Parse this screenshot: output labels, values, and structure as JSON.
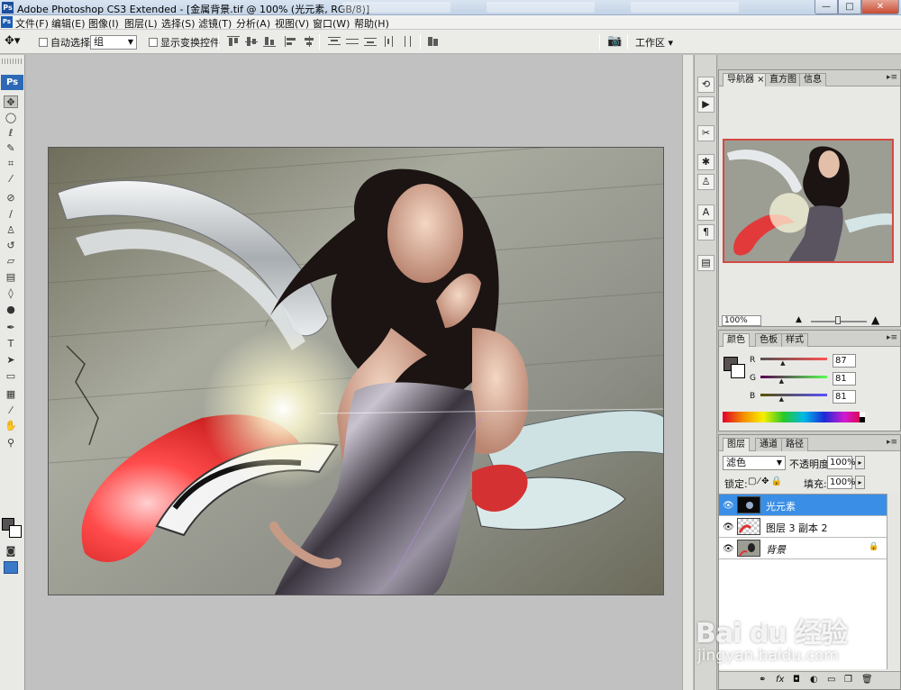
{
  "window": {
    "title": "Adobe Photoshop CS3 Extended - [金属背景.tif @ 100% (光元素, RGB/8)]",
    "controls": {
      "minimize": "—",
      "maximize": "□",
      "close": "✕"
    }
  },
  "menubar": {
    "items": [
      "文件(F)",
      "编辑(E)",
      "图像(I)",
      "图层(L)",
      "选择(S)",
      "滤镜(T)",
      "分析(A)",
      "视图(V)",
      "窗口(W)",
      "帮助(H)"
    ]
  },
  "options": {
    "auto_select_label": "自动选择:",
    "auto_select_value": "组",
    "show_transform_label": "显示变换控件",
    "workspace_label": "工作区 ▾"
  },
  "toolbox": {
    "badge": "Ps",
    "tools": [
      {
        "name": "move-tool",
        "glyph": "✥"
      },
      {
        "name": "marquee-tool",
        "glyph": "◯"
      },
      {
        "name": "lasso-tool",
        "glyph": "ℓ"
      },
      {
        "name": "quick-select-tool",
        "glyph": "✎"
      },
      {
        "name": "crop-tool",
        "glyph": "⌗"
      },
      {
        "name": "eyedropper-tool",
        "glyph": "⁄"
      },
      {
        "name": "healing-tool",
        "glyph": "⊘"
      },
      {
        "name": "brush-tool",
        "glyph": "∕"
      },
      {
        "name": "stamp-tool",
        "glyph": "♙"
      },
      {
        "name": "history-brush-tool",
        "glyph": "↺"
      },
      {
        "name": "eraser-tool",
        "glyph": "▱"
      },
      {
        "name": "gradient-tool",
        "glyph": "▤"
      },
      {
        "name": "blur-tool",
        "glyph": "◊"
      },
      {
        "name": "dodge-tool",
        "glyph": "●"
      },
      {
        "name": "pen-tool",
        "glyph": "✒"
      },
      {
        "name": "type-tool",
        "glyph": "T"
      },
      {
        "name": "path-select-tool",
        "glyph": "➤"
      },
      {
        "name": "shape-tool",
        "glyph": "▭"
      },
      {
        "name": "notes-tool",
        "glyph": "▦"
      },
      {
        "name": "eyedropper2-tool",
        "glyph": "⁄"
      },
      {
        "name": "hand-tool",
        "glyph": "✋"
      },
      {
        "name": "zoom-tool",
        "glyph": "⚲"
      }
    ]
  },
  "navigator": {
    "tabs": [
      "导航器",
      "直方图",
      "信息"
    ],
    "zoom": "100%"
  },
  "color": {
    "tabs": [
      "颜色",
      "色板",
      "样式"
    ],
    "channels": [
      {
        "label": "R",
        "value": "87",
        "position": 0.34
      },
      {
        "label": "G",
        "value": "81",
        "position": 0.32
      },
      {
        "label": "B",
        "value": "81",
        "position": 0.32
      }
    ],
    "foreground": "#575151"
  },
  "layers": {
    "tabs": [
      "图层",
      "通道",
      "路径"
    ],
    "blend_mode": "滤色",
    "opacity_label": "不透明度:",
    "opacity": "100%",
    "lock_label": "锁定:",
    "fill_label": "填充:",
    "fill": "100%",
    "items": [
      {
        "name": "光元素",
        "selected": true
      },
      {
        "name": "图层 3 副本 2",
        "selected": false
      },
      {
        "name": "背景",
        "selected": false,
        "locked": true
      }
    ],
    "footer_icons": [
      "link-icon",
      "fx-icon",
      "mask-icon",
      "adjustment-icon",
      "group-icon",
      "new-layer-icon",
      "trash-icon"
    ]
  },
  "watermark": {
    "line1": "Bai du 经验",
    "line2": "jingyan.baidu.com"
  },
  "colors": {
    "selection": "#3a8ee6",
    "accent": "#2d69b6"
  }
}
